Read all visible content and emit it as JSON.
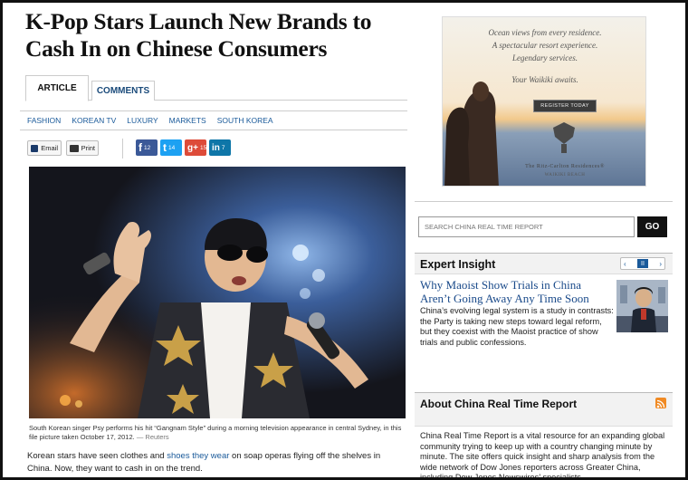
{
  "article": {
    "headline": "K-Pop Stars Launch New Brands to Cash In on Chinese Consumers",
    "tabs": [
      {
        "label": "ARTICLE"
      },
      {
        "label": "COMMENTS"
      }
    ],
    "topics": [
      "FASHION",
      "KOREAN TV",
      "LUXURY",
      "MARKETS",
      "SOUTH KOREA"
    ],
    "share": {
      "email_label": "Email",
      "print_label": "Print",
      "facebook": {
        "glyph": "f",
        "count": "12"
      },
      "twitter": {
        "glyph": "t",
        "count": "14"
      },
      "googleplus": {
        "glyph": "g+",
        "count": "15"
      },
      "linkedin": {
        "glyph": "in",
        "count": "7"
      }
    },
    "caption": "South Korean singer Psy performs his hit “Gangnam Style” during a morning television appearance in central Sydney, in this file picture taken October 17, 2012.",
    "caption_source": " — Reuters",
    "body_before_link": "Korean stars have seen clothes and ",
    "body_link": "shoes they wear",
    "body_after_link": " on soap operas flying off the shelves in China. Now, they want to cash in on the trend."
  },
  "ad": {
    "line1": "Ocean views from every residence.",
    "line2": "A spectacular resort experience.",
    "line3": "Legendary services.",
    "line4": "Your Waikiki awaits.",
    "button": "REGISTER TODAY",
    "brand": "The Ritz-Carlton Residences®",
    "brand_sub": "WAIKIKI BEACH"
  },
  "sidebar": {
    "search_placeholder": "SEARCH CHINA REAL TIME REPORT",
    "search_button": "GO",
    "expert": {
      "title": "Expert Insight",
      "pager_prev": "‹",
      "pager_pause": "II",
      "pager_next": "›",
      "headline": "Why Maoist Show Trials in China Aren’t Going Away Any Time Soon",
      "text": "China’s evolving legal system is a study in contrasts: the Party is taking new steps toward legal reform, but they coexist with the Maoist practice of show trials and public confessions."
    },
    "about": {
      "title": "About China Real Time Report",
      "text": "China Real Time Report is a vital resource for an expanding global community trying to keep up with a country changing minute by minute. The site offers quick insight and sharp analysis from the wide network of Dow Jones reporters across Greater China, including Dow Jones Newswires’ specialists"
    }
  },
  "colors": {
    "link": "#1a5a9a",
    "facebook": "#3b5998",
    "twitter": "#1da1f2",
    "googleplus": "#dd4b39",
    "linkedin": "#0e76a8",
    "rss": "#f08a24"
  }
}
